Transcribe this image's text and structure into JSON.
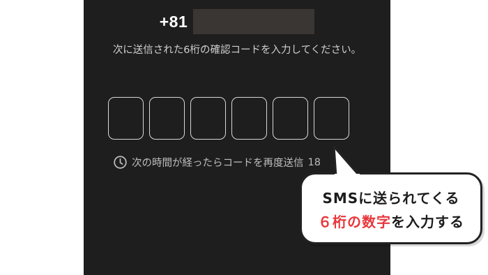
{
  "phone": {
    "country_code": "+81"
  },
  "instruction": "次に送信された6桁の確認コードを入力してください。",
  "code_inputs": [
    "",
    "",
    "",
    "",
    "",
    ""
  ],
  "resend": {
    "text": "次の時間が経ったらコードを再度送信",
    "countdown": "18"
  },
  "callout": {
    "line1": "SMSに送られてくる",
    "line2_highlight": "６桁の数字",
    "line2_rest": "を入力する"
  },
  "colors": {
    "screen_bg": "#1e1e1e",
    "highlight": "#e8373c",
    "box_border": "#d8d8d8"
  },
  "icons": {
    "clock": "clock-icon"
  }
}
